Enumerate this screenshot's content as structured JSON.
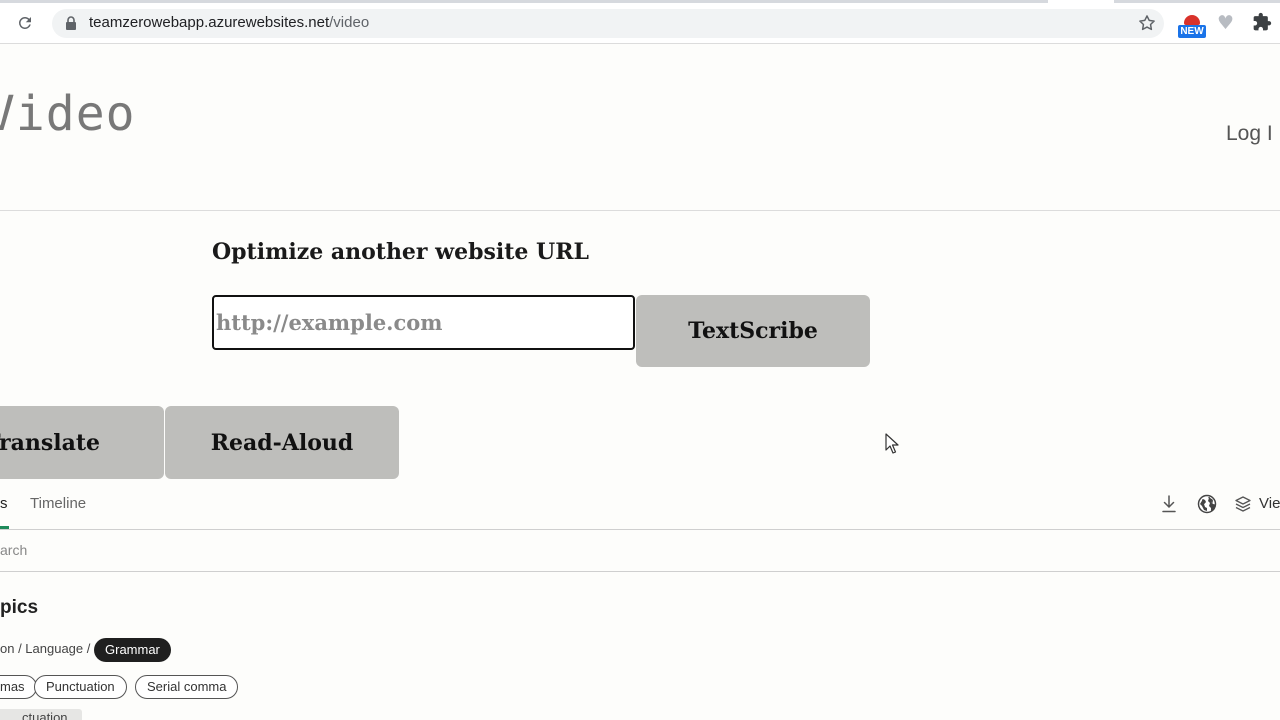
{
  "browser": {
    "url_host": "teamzerowebapp.azurewebsites.net",
    "url_path": "/video",
    "extension_badge": "NEW"
  },
  "header": {
    "logo_text": "Video",
    "login_label": "Log I"
  },
  "form": {
    "heading": "Optimize another website URL",
    "url_placeholder": "http://example.com",
    "submit_label": "TextScribe"
  },
  "actions": {
    "translate_label": "Translate",
    "read_aloud_label": "Read-Aloud"
  },
  "tabs": {
    "active_label": "s",
    "timeline_label": "Timeline",
    "view_label": "Vie"
  },
  "search": {
    "placeholder": "arch"
  },
  "topics": {
    "heading": "pics",
    "breadcrumb": "on / Language /",
    "active_crumb": "Grammar",
    "chips": [
      "mas",
      "Punctuation",
      "Serial comma"
    ],
    "partial_chip": "ctuation"
  }
}
